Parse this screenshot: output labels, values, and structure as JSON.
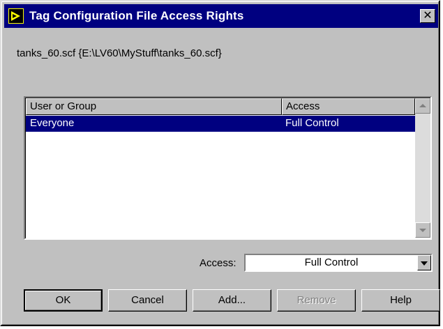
{
  "window": {
    "title": "Tag Configuration File Access Rights",
    "close_glyph": "✕"
  },
  "file_path": "tanks_60.scf {E:\\LV60\\MyStuff\\tanks_60.scf}",
  "permissions_table": {
    "columns": [
      "User or Group",
      "Access"
    ],
    "rows": [
      {
        "user": "Everyone",
        "access": "Full Control",
        "selected": true
      }
    ]
  },
  "access_field": {
    "label": "Access:",
    "value": "Full Control"
  },
  "buttons": {
    "ok": "OK",
    "cancel": "Cancel",
    "add": "Add...",
    "remove": "Remove",
    "help": "Help"
  },
  "colors": {
    "titlebar": "#000080",
    "selection": "#000080",
    "face": "#c0c0c0"
  },
  "icons": {
    "title_icon": "labview-vi-icon",
    "scroll_up": "arrow-up-icon",
    "scroll_down": "arrow-down-icon",
    "dropdown": "chevron-down-icon"
  }
}
